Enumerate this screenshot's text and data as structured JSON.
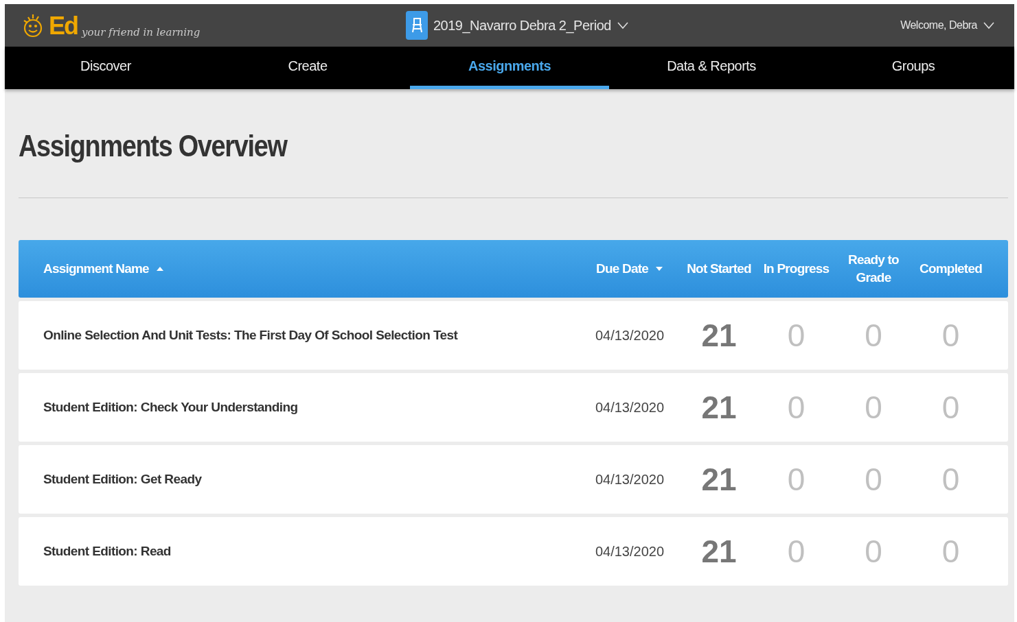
{
  "header": {
    "logo_text": "Ed",
    "tagline": "your friend in learning",
    "class_selector": "2019_Navarro Debra 2_Period",
    "user_menu": "Welcome, Debra"
  },
  "nav": [
    {
      "label": "Discover",
      "selected": false
    },
    {
      "label": "Create",
      "selected": false
    },
    {
      "label": "Assignments",
      "selected": true
    },
    {
      "label": "Data & Reports",
      "selected": false
    },
    {
      "label": "Groups",
      "selected": false
    }
  ],
  "page_title": "Assignments Overview",
  "table": {
    "columns": [
      {
        "label": "Assignment Name",
        "sorted_ascending": true,
        "sorted_descending": false
      },
      {
        "label": "Due Date",
        "sorted_ascending": false,
        "sorted_descending": true
      },
      {
        "label": "Not Started",
        "sorted_ascending": false,
        "sorted_descending": false
      },
      {
        "label": "In Progress",
        "sorted_ascending": false,
        "sorted_descending": false
      },
      {
        "label": "Ready to Grade",
        "sorted_ascending": false,
        "sorted_descending": false
      },
      {
        "label": "Completed",
        "sorted_ascending": false,
        "sorted_descending": false
      }
    ],
    "rows": [
      {
        "name": "Online Selection And Unit Tests: The First Day Of School Selection Test",
        "due_date": "04/13/2020",
        "counts": [
          {
            "value": "21",
            "highlighted": true
          },
          {
            "value": "0",
            "highlighted": false
          },
          {
            "value": "0",
            "highlighted": false
          },
          {
            "value": "0",
            "highlighted": false
          }
        ]
      },
      {
        "name": "Student Edition: Check Your Understanding",
        "due_date": "04/13/2020",
        "counts": [
          {
            "value": "21",
            "highlighted": true
          },
          {
            "value": "0",
            "highlighted": false
          },
          {
            "value": "0",
            "highlighted": false
          },
          {
            "value": "0",
            "highlighted": false
          }
        ]
      },
      {
        "name": "Student Edition: Get Ready",
        "due_date": "04/13/2020",
        "counts": [
          {
            "value": "21",
            "highlighted": true
          },
          {
            "value": "0",
            "highlighted": false
          },
          {
            "value": "0",
            "highlighted": false
          },
          {
            "value": "0",
            "highlighted": false
          }
        ]
      },
      {
        "name": "Student Edition: Read",
        "due_date": "04/13/2020",
        "counts": [
          {
            "value": "21",
            "highlighted": true
          },
          {
            "value": "0",
            "highlighted": false
          },
          {
            "value": "0",
            "highlighted": false
          },
          {
            "value": "0",
            "highlighted": false
          }
        ]
      }
    ]
  }
}
